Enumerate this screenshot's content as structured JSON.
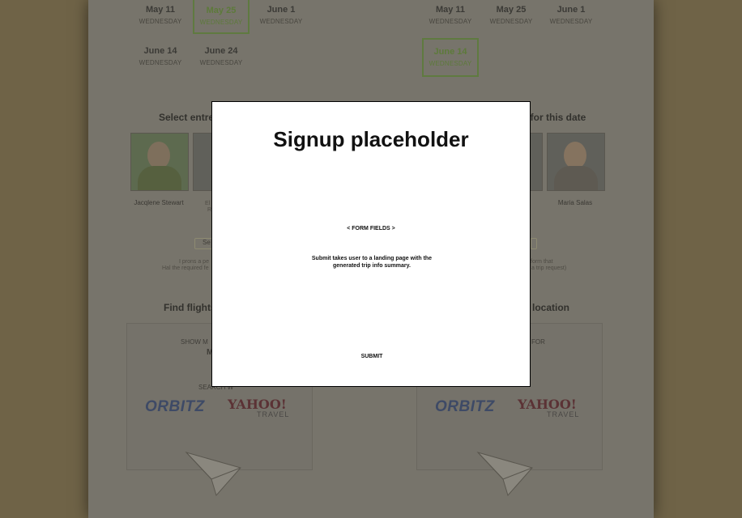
{
  "dates_left": [
    {
      "date": "May 11",
      "day": "WEDNESDAY",
      "selected": false
    },
    {
      "date": "May 25",
      "day": "WEDNESDAY",
      "selected": true
    },
    {
      "date": "June 1",
      "day": "WEDNESDAY",
      "selected": false
    },
    {
      "date": "June 14",
      "day": "WEDNESDAY",
      "selected": false
    },
    {
      "date": "June 24",
      "day": "WEDNESDAY",
      "selected": false
    }
  ],
  "dates_right": [
    {
      "date": "May 11",
      "day": "WEDNESDAY",
      "selected": false
    },
    {
      "date": "May 25",
      "day": "WEDNESDAY",
      "selected": false
    },
    {
      "date": "June 1",
      "day": "WEDNESDAY",
      "selected": false
    },
    {
      "date": "June 14",
      "day": "WEDNESDAY",
      "selected": true
    }
  ],
  "entrepreneurs": {
    "left_title": "Select entrep",
    "right_title": "rs for this date",
    "people": [
      {
        "name": "Jacqlene Stewart"
      },
      {
        "name": "Maria Salas"
      }
    ],
    "partial_left_labels": [
      "El",
      "R"
    ]
  },
  "hints": {
    "left_line1": "I prons a pe",
    "left_line2": "Hal the required fe",
    "right_line1": "form that",
    "right_line2": "a trip request)"
  },
  "pill_left": "Se",
  "flights": {
    "left_title": "Find flights",
    "right_title": "s location",
    "left_panel": {
      "show_label": "SHOW M",
      "bold_letter": "M",
      "search_label": "SEARCH W"
    },
    "right_panel": {
      "for_label": "FOR"
    },
    "brands": {
      "orbitz": "ORBITZ",
      "yahoo": "YAHOO!",
      "travel": "TRAVEL"
    }
  },
  "modal": {
    "title": "Signup placeholder",
    "form_fields": "< FORM FIELDS >",
    "note": "Submit takes user to a landing page with the generated trip info summary.",
    "submit_label": "SUBMIT"
  }
}
